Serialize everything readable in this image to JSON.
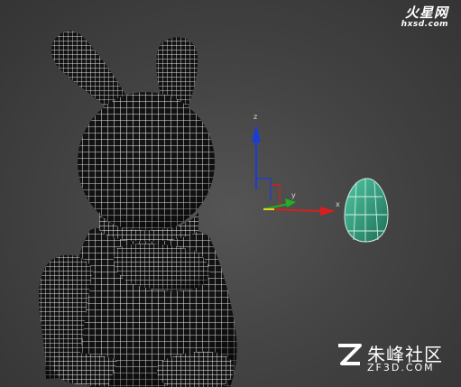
{
  "viewport": {
    "background": "#444444",
    "mesh_color": "#ffffff",
    "gizmo": {
      "z_label": "z",
      "x_label": "x",
      "y_label": "y",
      "z_color": "#1a3dd8",
      "x_color": "#d81e1e",
      "y_color": "#20b020"
    },
    "egg_color": "#2f9a78"
  },
  "watermarks": {
    "top_brand": "火星网",
    "top_url": "hxsd.com",
    "bottom_brand": "朱峰社区",
    "bottom_url": "ZF3D.COM"
  }
}
